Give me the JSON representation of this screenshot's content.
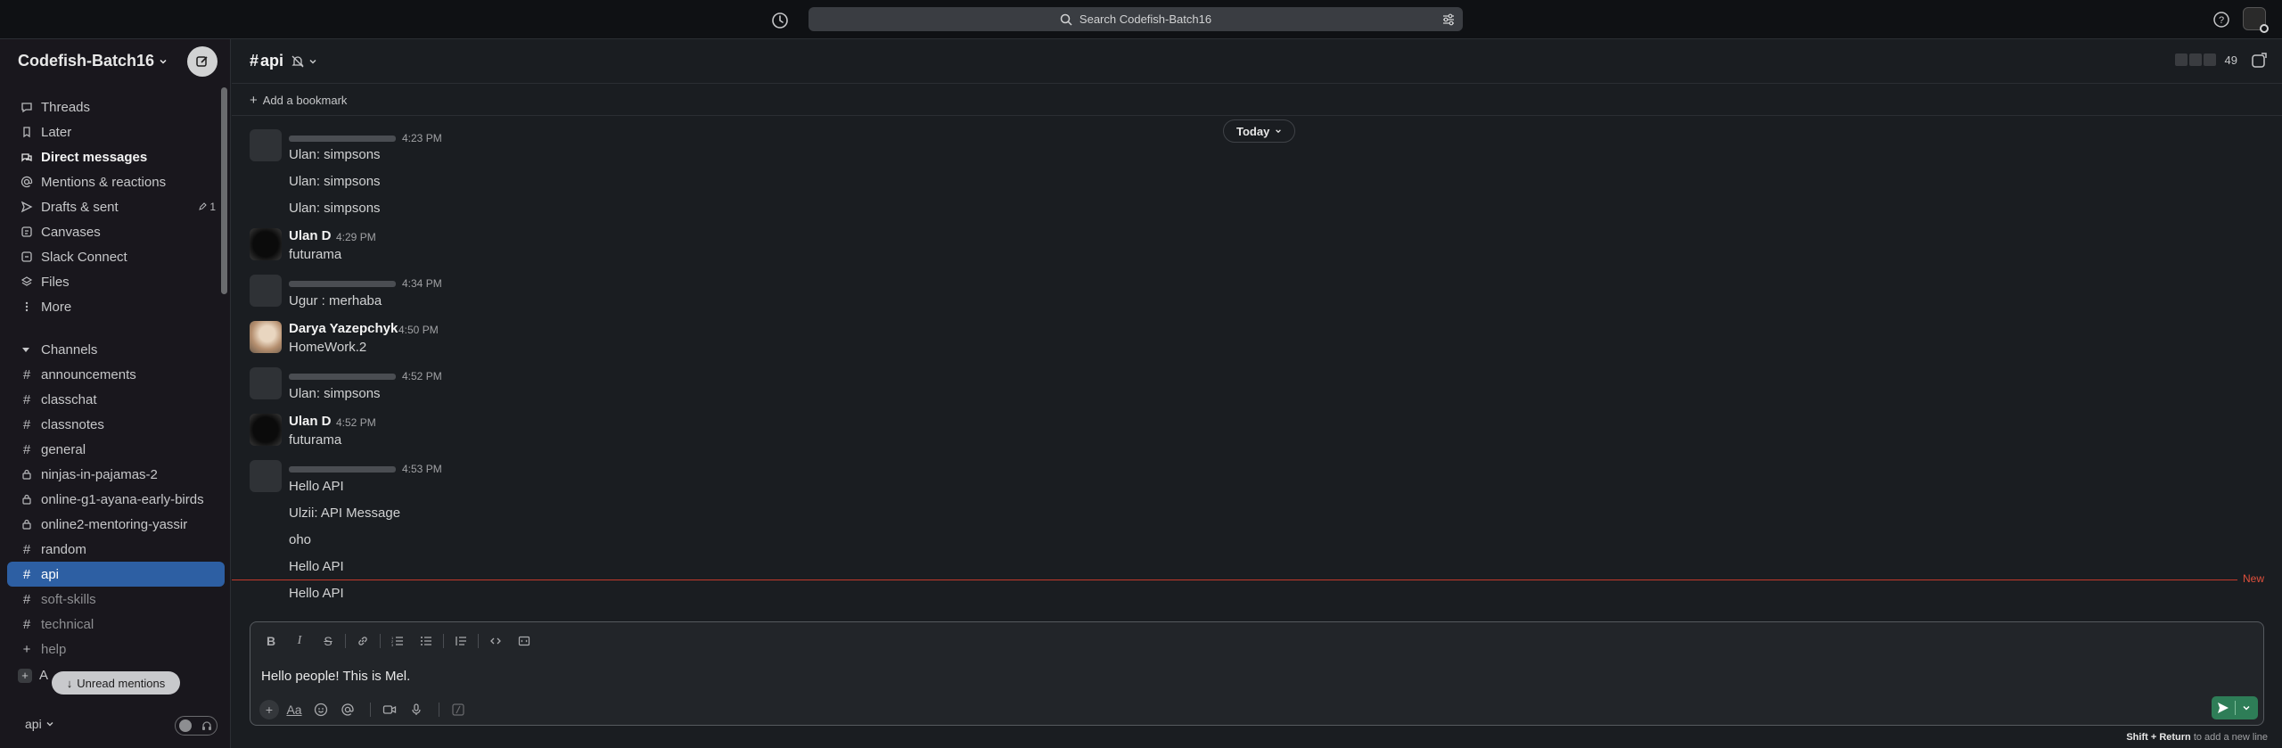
{
  "topbar": {
    "search_placeholder": "Search Codefish-Batch16",
    "icons": [
      "history-icon",
      "search-icon",
      "filter-icon",
      "help-icon",
      "avatar"
    ]
  },
  "workspace": {
    "name": "Codefish-Batch16"
  },
  "nav": [
    {
      "label": "Threads",
      "icon": "threads-icon"
    },
    {
      "label": "Later",
      "icon": "bookmark-icon"
    },
    {
      "label": "Direct messages",
      "icon": "dm-icon",
      "bold": true
    },
    {
      "label": "Mentions & reactions",
      "icon": "at-icon"
    },
    {
      "label": "Drafts & sent",
      "icon": "send-icon",
      "count": "1"
    },
    {
      "label": "Canvases",
      "icon": "canvas-icon"
    },
    {
      "label": "Slack Connect",
      "icon": "connect-icon"
    },
    {
      "label": "Files",
      "icon": "files-icon"
    },
    {
      "label": "More",
      "icon": "more-icon"
    }
  ],
  "channels_header": "Channels",
  "channels": [
    {
      "name": "announcements",
      "private": false
    },
    {
      "name": "classchat",
      "private": false
    },
    {
      "name": "classnotes",
      "private": false
    },
    {
      "name": "general",
      "private": false
    },
    {
      "name": "ninjas-in-pajamas-2",
      "private": true
    },
    {
      "name": "online-g1-ayana-early-birds",
      "private": true
    },
    {
      "name": "online2-mentoring-yassir",
      "private": true
    },
    {
      "name": "random",
      "private": false
    },
    {
      "name": "api",
      "private": false,
      "active": true
    },
    {
      "name": "soft-skills",
      "private": false,
      "dim": true
    },
    {
      "name": "technical",
      "private": false,
      "dim": true
    },
    {
      "name": "help",
      "private": false,
      "dim": true
    }
  ],
  "add_channel_label": "A",
  "unread_mentions": "Unread mentions",
  "sidebar_footer": {
    "channel": "api"
  },
  "channel_header": {
    "name": "api",
    "member_count": "49"
  },
  "bookmark": {
    "add_label": "Add a bookmark"
  },
  "messages": {
    "today_label": "Today",
    "items": [
      {
        "name": "",
        "time": "4:23 PM",
        "lines": [
          "Ulan: simpsons",
          "Ulan: simpsons",
          "Ulan: simpsons"
        ]
      },
      {
        "name": "Ulan D",
        "time": "4:29 PM",
        "lines": [
          "futurama"
        ]
      },
      {
        "name": "",
        "time": "4:34 PM",
        "lines": [
          "Ugur : merhaba"
        ]
      },
      {
        "name": "Darya Yazepchyk",
        "time": "4:50 PM",
        "lines": [
          "HomeWork.2"
        ]
      },
      {
        "name": "",
        "time": "4:52 PM",
        "lines": [
          "Ulan: simpsons"
        ]
      },
      {
        "name": "Ulan D",
        "time": "4:52 PM",
        "lines": [
          "futurama"
        ]
      },
      {
        "name": "",
        "time": "4:53 PM",
        "lines": [
          "Hello API",
          "Ulzii: API Message",
          "oho",
          "Hello API",
          "Hello API"
        ]
      }
    ],
    "new_label": "New"
  },
  "composer": {
    "text": "Hello people! This is Mel.",
    "hint_keys": "Shift + Return",
    "hint_rest": " to add a new line"
  }
}
